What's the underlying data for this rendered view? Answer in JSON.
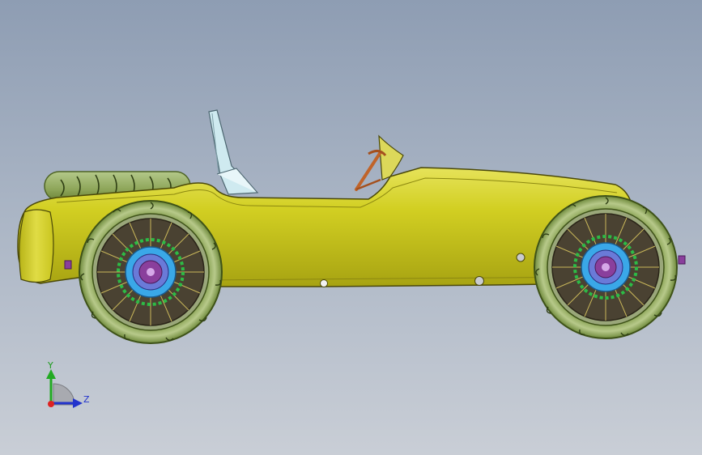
{
  "viewport": {
    "background_top": "#8e9db3",
    "background_bottom": "#c9ced6"
  },
  "model": {
    "body_color": "#c8c41a",
    "tire_color": "#9fb36a",
    "seat_color": "#cfeaf0",
    "steering_wheel_color": "#c0642a",
    "hub_color": "#8a3f9c"
  },
  "triad": {
    "y_label": "Y",
    "z_label": "Z",
    "y_axis_color": "#22aa22",
    "z_axis_color": "#2233cc",
    "x_axis_color": "#dd2222"
  }
}
